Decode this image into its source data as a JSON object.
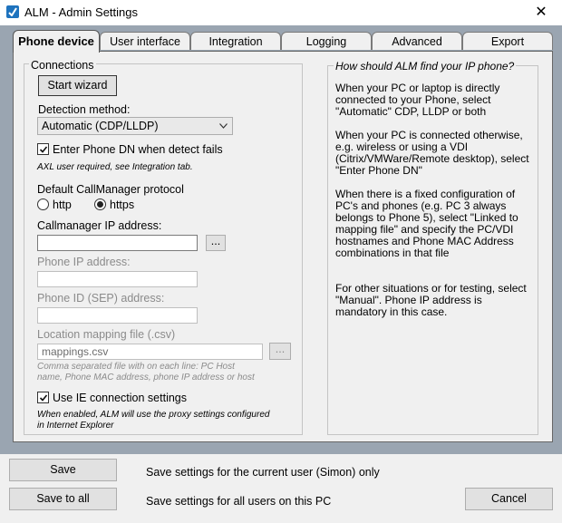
{
  "window": {
    "title": "ALM - Admin Settings",
    "close_glyph": "✕",
    "icon": "alm-app-icon"
  },
  "tabs": [
    {
      "label": "Phone device"
    },
    {
      "label": "User interface"
    },
    {
      "label": "Integration"
    },
    {
      "label": "Logging"
    },
    {
      "label": "Advanced"
    },
    {
      "label": "Export"
    }
  ],
  "connections": {
    "group_title": "Connections",
    "start_wizard": "Start wizard",
    "detection_label": "Detection method:",
    "detection_value": "Automatic (CDP/LLDP)",
    "enter_dn_label": "Enter Phone DN when detect fails",
    "enter_dn_checked": true,
    "axl_note": "AXL user required, see Integration tab.",
    "protocol_label": "Default CallManager protocol",
    "protocol_http": "http",
    "protocol_https": "https",
    "protocol_selected": "https",
    "callmanager_label": "Callmanager IP address:",
    "callmanager_value": "",
    "browse_label": "...",
    "phone_ip_label": "Phone IP address:",
    "phone_ip_value": "",
    "phone_id_label": "Phone ID (SEP) address:",
    "phone_id_value": "",
    "mapping_label": "Location mapping file (.csv)",
    "mapping_value": "mappings.csv",
    "mapping_browse": "...",
    "mapping_note_1": "Comma separated file with on each line: PC Host",
    "mapping_note_2": "name, Phone MAC address, phone IP address or host",
    "ie_label": "Use IE connection settings",
    "ie_checked": true,
    "ie_note_1": "When enabled, ALM will use the proxy settings configured",
    "ie_note_2": "in Internet Explorer"
  },
  "help": {
    "title": "How should ALM find your IP phone?",
    "p1": "When your PC or laptop is directly connected to your Phone, select \"Automatic\" CDP, LLDP or both",
    "p2": "When your PC is connected otherwise, e.g. wireless or using a VDI (Citrix/VMWare/Remote desktop), select \"Enter Phone DN\"",
    "p3": "When there is a fixed configuration of PC's and phones (e.g. PC 3 always belongs to Phone 5), select \"Linked to mapping file\" and specify the PC/VDI hostnames and Phone MAC Address combinations in that file",
    "p4": "For other situations or for testing, select \"Manual\". Phone IP address is mandatory in this case."
  },
  "footer": {
    "save_label": "Save",
    "save_desc": "Save settings for the current user (Simon) only",
    "save_all_label": "Save to all",
    "save_all_desc": "Save settings for all users on this PC",
    "cancel_label": "Cancel"
  }
}
